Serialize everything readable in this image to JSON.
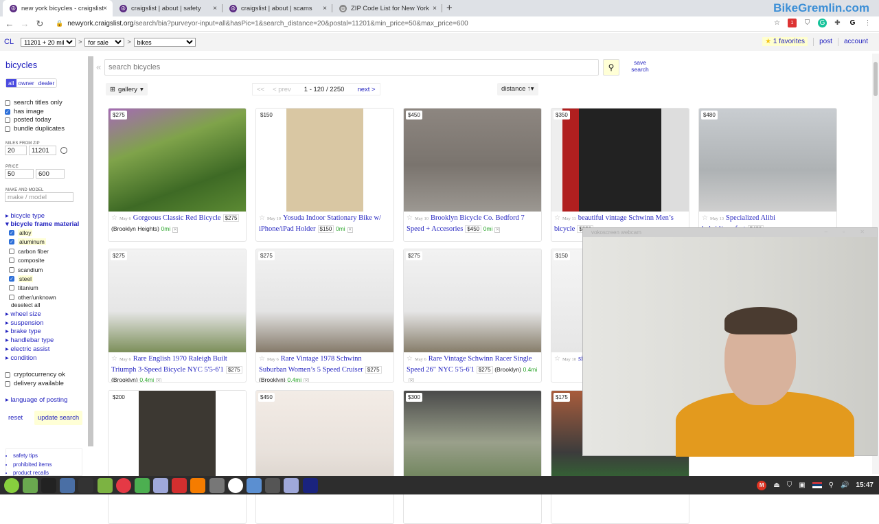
{
  "browser": {
    "tabs": [
      {
        "title": "new york bicycles - craigslist",
        "icon": "craigslist-peace-icon",
        "active": true
      },
      {
        "title": "craigslist | about | safety",
        "icon": "craigslist-peace-icon",
        "active": false
      },
      {
        "title": "craigslist | about | scams",
        "icon": "craigslist-peace-icon",
        "active": false
      },
      {
        "title": "ZIP Code List for New York",
        "icon": "globe-icon",
        "active": false
      }
    ],
    "new_tab": "+",
    "close_glyph": "×",
    "url_domain": "newyork.craigslist.org",
    "url_path": "/search/bia?purveyor-input=all&hasPic=1&search_distance=20&postal=11201&min_price=50&max_price=600",
    "watermark": "BikeGremlin.com",
    "extension_badge": "1"
  },
  "header": {
    "logo": "CL",
    "area_select": "11201 + 20 miles",
    "section_select": "for sale",
    "category_select": "bikes",
    "separator": ">",
    "favorites": "1 favorites",
    "post": "post",
    "account": "account"
  },
  "sidebar": {
    "title": "bicycles",
    "seller_filter": [
      {
        "label": "all",
        "active": true
      },
      {
        "label": "owner",
        "active": false
      },
      {
        "label": "dealer",
        "active": false
      }
    ],
    "options": [
      {
        "label": "search titles only",
        "checked": false
      },
      {
        "label": "has image",
        "checked": true
      },
      {
        "label": "posted today",
        "checked": false
      },
      {
        "label": "bundle duplicates",
        "checked": false
      }
    ],
    "miles_label": "MILES FROM ZIP",
    "miles_value": "20",
    "zip_value": "11201",
    "price_label": "PRICE",
    "price_min": "50",
    "price_max": "600",
    "make_label": "MAKE AND MODEL",
    "make_placeholder": "make / model",
    "facet_bicycle_type": "bicycle type",
    "facet_frame_material": "bicycle frame material",
    "materials": [
      {
        "label": "alloy",
        "checked": true
      },
      {
        "label": "aluminum",
        "checked": true
      },
      {
        "label": "carbon fiber",
        "checked": false
      },
      {
        "label": "composite",
        "checked": false
      },
      {
        "label": "scandium",
        "checked": false
      },
      {
        "label": "steel",
        "checked": true
      },
      {
        "label": "titanium",
        "checked": false
      },
      {
        "label": "other/unknown",
        "checked": false
      }
    ],
    "deselect_all": "deselect all",
    "facets": [
      "wheel size",
      "suspension",
      "brake type",
      "handlebar type",
      "electric assist",
      "condition"
    ],
    "extra_options": [
      {
        "label": "cryptocurrency ok",
        "checked": false
      },
      {
        "label": "delivery available",
        "checked": false
      }
    ],
    "language": "language of posting",
    "reset": "reset",
    "update": "update search",
    "footer_links": [
      "safety tips",
      "prohibited items",
      "product recalls"
    ]
  },
  "main": {
    "collapse": "«",
    "search_placeholder": "search bicycles",
    "save_search_1": "save",
    "save_search_2": "search",
    "view_mode": "gallery",
    "pager": {
      "first": "<<",
      "prev": "< prev",
      "range": "1 - 120 / 2250",
      "next": "next >"
    },
    "sort": "distance ↑▾",
    "listings": [
      {
        "price": "$275",
        "date": "May 6",
        "title": "Gorgeous Classic Red Bicycle",
        "hood": "(Brooklyn Heights)",
        "dist": "0mi"
      },
      {
        "price": "$150",
        "date": "May 10",
        "title": "Yosuda Indoor Stationary Bike w/ iPhone/iPad Holder",
        "hood": "",
        "dist": "0mi"
      },
      {
        "price": "$450",
        "date": "May 10",
        "title": "Brooklyn Bicycle Co. Bedford 7 Speed + Accesories",
        "hood": "",
        "dist": "0mi"
      },
      {
        "price": "$350",
        "date": "May 11",
        "title": "beautiful vintage Schwinn Men’s bicycle",
        "hood": "",
        "dist": ""
      },
      {
        "price": "$480",
        "date": "May 13",
        "title": "Specialized Alibi hybrid/comfort",
        "hood": "",
        "dist": ""
      },
      {
        "price": "$275",
        "date": "May 6",
        "title": "Rare English 1970 Raleigh Built Triumph 3-Speed Bicycle NYC 5'5-6'1",
        "hood": "(Brooklyn)",
        "dist": "0.4mi"
      },
      {
        "price": "$275",
        "date": "May 6",
        "title": "Rare Vintage 1978 Schwinn Suburban Women’s 5 Speed Cruiser",
        "hood": "(Brooklyn)",
        "dist": "0.4mi"
      },
      {
        "price": "$275",
        "date": "May 6",
        "title": "Rare Vintage Schwinn Racer Single Speed 26\" NYC 5'5-6'1",
        "hood": "(Brooklyn)",
        "dist": "0.4mi"
      },
      {
        "price": "$150",
        "date": "May 10",
        "title": "singlespeed",
        "hood": "",
        "dist": ""
      },
      {
        "price": "$200",
        "date": "",
        "title": "",
        "hood": "",
        "dist": ""
      },
      {
        "price": "$450",
        "date": "",
        "title": "",
        "hood": "",
        "dist": ""
      },
      {
        "price": "$300",
        "date": "",
        "title": "",
        "hood": "",
        "dist": ""
      },
      {
        "price": "$175",
        "date": "",
        "title": "",
        "hood": "",
        "dist": ""
      }
    ]
  },
  "webcam": {
    "title": "vokoscreen webcam"
  },
  "taskbar": {
    "apps": [
      "mint-menu",
      "desktop",
      "terminal",
      "file-manager",
      "terminal-2",
      "files",
      "app-red",
      "app-green",
      "notes",
      "app-x",
      "app-orange",
      "chrome",
      "yandex",
      "editor",
      "calculator",
      "notes-2",
      "app-headset"
    ],
    "clock": "15:47"
  }
}
